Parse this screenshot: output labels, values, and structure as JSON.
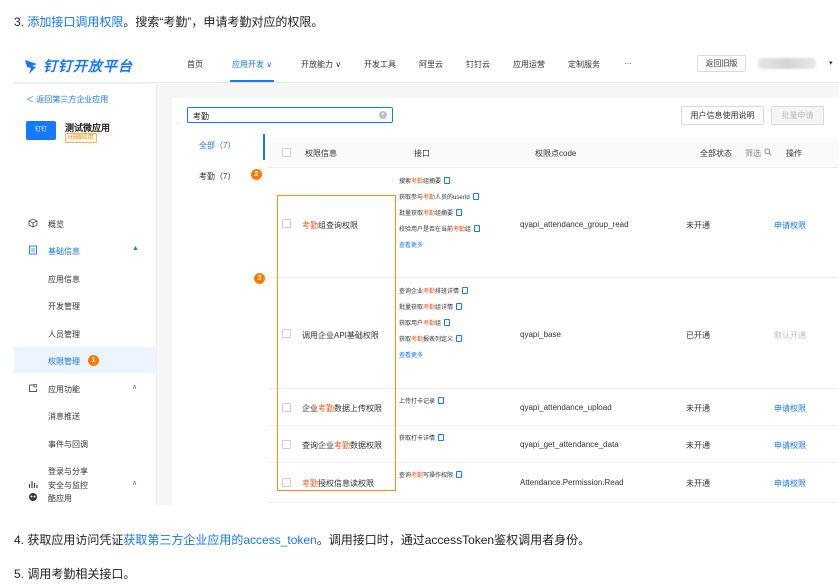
{
  "doc": {
    "step3": {
      "num": "3.",
      "link": "添加接口调用权限",
      "rest": "。搜索“考勤”，申请考勤对应的权限。"
    },
    "step4": {
      "pre": "4. 获取应用访问凭证",
      "link": "获取第三方企业应用的access_token",
      "rest": "。调用接口时，通过accessToken鉴权调用者身份。"
    },
    "step5": {
      "text": "5. 调用考勤相关接口。"
    }
  },
  "nav": {
    "logo": "钉钉开放平台",
    "items": [
      "首页",
      "应用开发 ∨",
      "开放能力 ∨",
      "开发工具",
      "阿里云",
      "钉钉云",
      "应用运营",
      "定制服务",
      "···"
    ],
    "old_version": "返回旧版",
    "caret": "▾"
  },
  "sidebar": {
    "back": "＜  返回第三方企业应用",
    "app_name": "测试微应用",
    "app_icon_text": "钉钉",
    "app_tag": "H5微应用",
    "items": [
      {
        "label": "概览",
        "icon": "cube-icon"
      },
      {
        "label": "基础信息",
        "icon": "document-icon",
        "caret": "▲"
      },
      {
        "label": "应用信息"
      },
      {
        "label": "开发管理"
      },
      {
        "label": "人员管理"
      },
      {
        "label": "权限管理",
        "badge": "1"
      },
      {
        "label": "应用功能",
        "icon": "puzzle-icon",
        "caret": "∧"
      },
      {
        "label": "消息推送"
      },
      {
        "label": "事件与回调"
      },
      {
        "label": "登录与分享"
      },
      {
        "label": "酷应用",
        "icon": "cool-app-icon"
      },
      {
        "label": "安全与监控",
        "icon": "chart-icon",
        "caret": "∧"
      }
    ]
  },
  "content": {
    "search_value": "考勤",
    "clear": "×",
    "btn_guide": "用户信息使用说明",
    "btn_batch": "批量申请",
    "categories": [
      {
        "label": "全部（7）"
      },
      {
        "label": "考勤（7）",
        "badge": "2"
      }
    ],
    "badge3": "3",
    "table": {
      "headers": [
        "权限信息",
        "接口",
        "权限点code",
        "全部状态",
        "筛选",
        "操作"
      ],
      "filter_icon": "search-icon",
      "rows": [
        {
          "perm_hl": "考勤",
          "perm_pre": "",
          "perm_post": "组查询权限",
          "apis": [
            {
              "pre": "搜索",
              "hl": "考勤",
              "post": "组摘要"
            },
            {
              "pre": "获取参与",
              "hl": "考勤",
              "post": "人员的userId"
            },
            {
              "pre": "批量获取",
              "hl": "考勤",
              "post": "组摘要"
            },
            {
              "pre": "校验用户是否在当前",
              "hl": "考勤",
              "post": "组"
            }
          ],
          "more": "查看更多",
          "code": "qyapi_attendance_group_read",
          "status": "未开通",
          "op": "申请权限"
        },
        {
          "perm_hl": "",
          "perm_pre": "调用企业API基础权限",
          "perm_post": "",
          "apis": [
            {
              "pre": "查询企业",
              "hl": "考勤",
              "post": "排班详情"
            },
            {
              "pre": "批量获取",
              "hl": "考勤",
              "post": "组详情"
            },
            {
              "pre": "获取用户",
              "hl": "考勤",
              "post": "组"
            },
            {
              "pre": "获取",
              "hl": "考勤",
              "post": "报表列定义"
            }
          ],
          "more": "查看更多",
          "code": "qyapi_base",
          "status": "已开通",
          "op": "默认开通"
        },
        {
          "perm_hl": "考勤",
          "perm_pre": "企业",
          "perm_post": "数据上传权限",
          "apis": [
            {
              "pre": "上传打卡记录",
              "hl": "",
              "post": ""
            }
          ],
          "code": "qyapi_attendance_upload",
          "status": "未开通",
          "op": "申请权限"
        },
        {
          "perm_hl": "考勤",
          "perm_pre": "查询企业",
          "perm_post": "数据权限",
          "apis": [
            {
              "pre": "获取打卡详情",
              "hl": "",
              "post": ""
            }
          ],
          "code": "qyapi_get_attendance_data",
          "status": "未开通",
          "op": "申请权限"
        },
        {
          "perm_hl": "考勤",
          "perm_pre": "",
          "perm_post": "授权信息读权限",
          "apis": [
            {
              "pre": "查询",
              "hl": "考勤",
              "post": "写操作权限"
            }
          ],
          "code": "Attendance.Permission.Read",
          "status": "未开通",
          "op": "申请权限"
        }
      ]
    }
  },
  "colors": {
    "accent": "#1677ff",
    "highlight": "#ff5a1f",
    "badge": "#ff7a00",
    "annotation_box": "#ff8a1f"
  }
}
